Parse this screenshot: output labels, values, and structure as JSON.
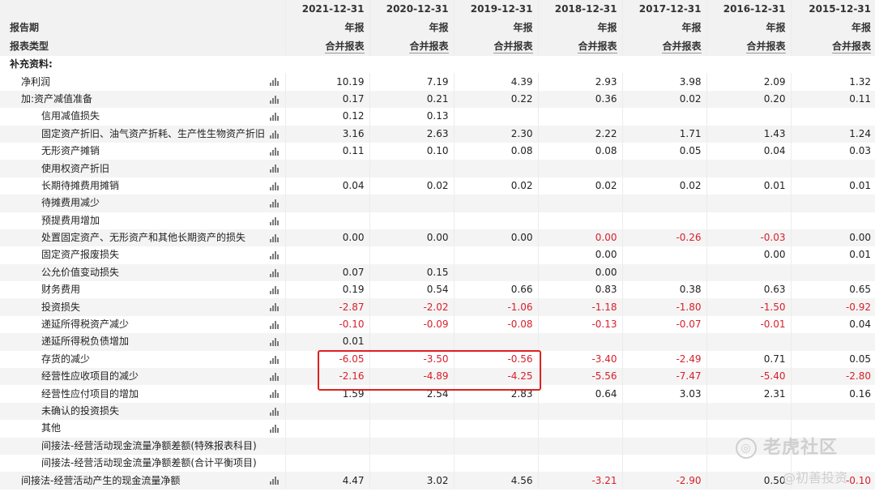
{
  "header": {
    "dates": [
      "2021-12-31",
      "2020-12-31",
      "2019-12-31",
      "2018-12-31",
      "2017-12-31",
      "2016-12-31",
      "2015-12-31"
    ],
    "period_label": "报告期",
    "type_label": "报表类型",
    "period_values": [
      "年报",
      "年报",
      "年报",
      "年报",
      "年报",
      "年报",
      "年报"
    ],
    "type_values": [
      "合并报表",
      "合并报表",
      "合并报表",
      "合并报表",
      "合并报表",
      "合并报表",
      "合并报表"
    ]
  },
  "section_title": "补充资料:",
  "rows": [
    {
      "label": "净利润",
      "indent": 1,
      "chart": true,
      "values": [
        "10.19",
        "7.19",
        "4.39",
        "2.93",
        "3.98",
        "2.09",
        "1.32"
      ]
    },
    {
      "label": "加:资产减值准备",
      "indent": 1,
      "chart": true,
      "values": [
        "0.17",
        "0.21",
        "0.22",
        "0.36",
        "0.02",
        "0.20",
        "0.11"
      ]
    },
    {
      "label": "信用减值损失",
      "indent": 2,
      "chart": true,
      "values": [
        "0.12",
        "0.13",
        "",
        "",
        "",
        "",
        ""
      ]
    },
    {
      "label": "固定资产折旧、油气资产折耗、生产性生物资产折旧",
      "indent": 2,
      "chart": true,
      "values": [
        "3.16",
        "2.63",
        "2.30",
        "2.22",
        "1.71",
        "1.43",
        "1.24"
      ]
    },
    {
      "label": "无形资产摊销",
      "indent": 2,
      "chart": true,
      "values": [
        "0.11",
        "0.10",
        "0.08",
        "0.08",
        "0.05",
        "0.04",
        "0.03"
      ]
    },
    {
      "label": "使用权资产折旧",
      "indent": 2,
      "chart": true,
      "values": [
        "",
        "",
        "",
        "",
        "",
        "",
        ""
      ]
    },
    {
      "label": "长期待摊费用摊销",
      "indent": 2,
      "chart": true,
      "values": [
        "0.04",
        "0.02",
        "0.02",
        "0.02",
        "0.02",
        "0.01",
        "0.01"
      ]
    },
    {
      "label": "待摊费用减少",
      "indent": 2,
      "chart": true,
      "values": [
        "",
        "",
        "",
        "",
        "",
        "",
        ""
      ]
    },
    {
      "label": "预提费用增加",
      "indent": 2,
      "chart": true,
      "values": [
        "",
        "",
        "",
        "",
        "",
        "",
        ""
      ]
    },
    {
      "label": "处置固定资产、无形资产和其他长期资产的损失",
      "indent": 2,
      "chart": true,
      "values": [
        "0.00",
        "0.00",
        "0.00",
        "0.00",
        "-0.26",
        "-0.03",
        "0.00"
      ],
      "neg": [
        false,
        false,
        false,
        true,
        true,
        true,
        false
      ]
    },
    {
      "label": "固定资产报废损失",
      "indent": 2,
      "chart": true,
      "values": [
        "",
        "",
        "",
        "0.00",
        "",
        "0.00",
        "0.01"
      ]
    },
    {
      "label": "公允价值变动损失",
      "indent": 2,
      "chart": true,
      "values": [
        "0.07",
        "0.15",
        "",
        "0.00",
        "",
        "",
        ""
      ]
    },
    {
      "label": "财务费用",
      "indent": 2,
      "chart": true,
      "values": [
        "0.19",
        "0.54",
        "0.66",
        "0.83",
        "0.38",
        "0.63",
        "0.65"
      ]
    },
    {
      "label": "投资损失",
      "indent": 2,
      "chart": true,
      "values": [
        "-2.87",
        "-2.02",
        "-1.06",
        "-1.18",
        "-1.80",
        "-1.50",
        "-0.92"
      ]
    },
    {
      "label": "递延所得税资产减少",
      "indent": 2,
      "chart": true,
      "values": [
        "-0.10",
        "-0.09",
        "-0.08",
        "-0.13",
        "-0.07",
        "-0.01",
        "0.04"
      ]
    },
    {
      "label": "递延所得税负债增加",
      "indent": 2,
      "chart": true,
      "values": [
        "0.01",
        "",
        "",
        "",
        "",
        "",
        ""
      ]
    },
    {
      "label": "存货的减少",
      "indent": 2,
      "chart": true,
      "values": [
        "-6.05",
        "-3.50",
        "-0.56",
        "-3.40",
        "-2.49",
        "0.71",
        "0.05"
      ]
    },
    {
      "label": "经营性应收项目的减少",
      "indent": 2,
      "chart": true,
      "values": [
        "-2.16",
        "-4.89",
        "-4.25",
        "-5.56",
        "-7.47",
        "-5.40",
        "-2.80"
      ]
    },
    {
      "label": "经营性应付项目的增加",
      "indent": 2,
      "chart": true,
      "values": [
        "1.59",
        "2.54",
        "2.83",
        "0.64",
        "3.03",
        "2.31",
        "0.16"
      ]
    },
    {
      "label": "未确认的投资损失",
      "indent": 2,
      "chart": true,
      "values": [
        "",
        "",
        "",
        "",
        "",
        "",
        ""
      ]
    },
    {
      "label": "其他",
      "indent": 2,
      "chart": true,
      "values": [
        "",
        "",
        "",
        "",
        "",
        "",
        ""
      ]
    },
    {
      "label": "间接法-经营活动现金流量净额差额(特殊报表科目)",
      "indent": 2,
      "chart": false,
      "values": [
        "",
        "",
        "",
        "",
        "",
        "",
        ""
      ]
    },
    {
      "label": "间接法-经营活动现金流量净额差额(合计平衡项目)",
      "indent": 2,
      "chart": false,
      "values": [
        "",
        "",
        "",
        "",
        "",
        "",
        ""
      ]
    },
    {
      "label": "间接法-经营活动产生的现金流量净额",
      "indent": 1,
      "chart": true,
      "values": [
        "4.47",
        "3.02",
        "4.56",
        "-3.21",
        "-2.90",
        "0.50",
        "-0.10"
      ]
    }
  ],
  "watermark": {
    "brand": "老虎社区",
    "author": "@初善投资"
  },
  "colors": {
    "negative": "#d8202b",
    "highlight": "#e02020"
  }
}
